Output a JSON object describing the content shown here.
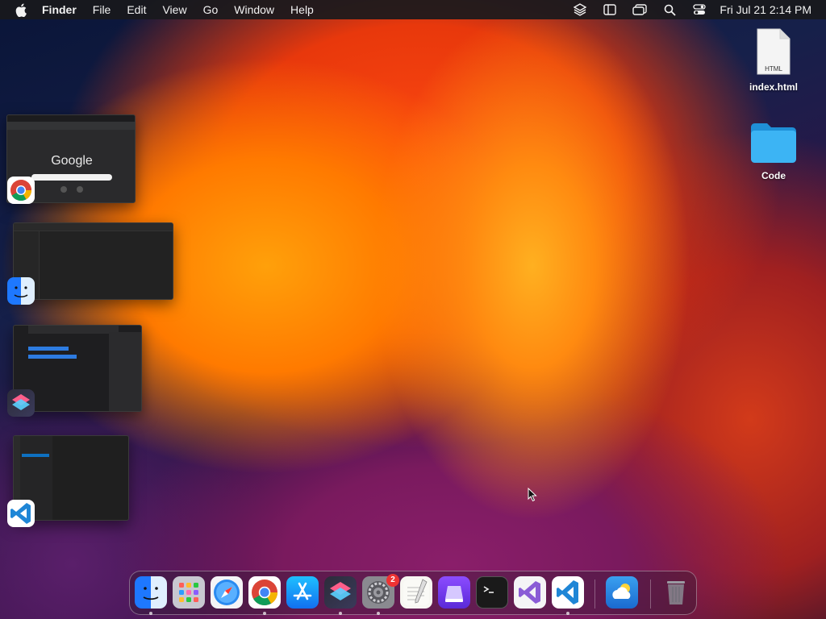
{
  "menubar": {
    "app_name": "Finder",
    "items": [
      "File",
      "Edit",
      "View",
      "Go",
      "Window",
      "Help"
    ],
    "clock": "Fri Jul 21  2:14 PM"
  },
  "desktop": {
    "files": [
      {
        "name": "index.html",
        "kind_label": "HTML"
      },
      {
        "name": "Code"
      }
    ]
  },
  "stage_manager": {
    "windows": [
      {
        "app": "Google Chrome",
        "content_text": "Google",
        "icon": "chrome-icon"
      },
      {
        "app": "Finder",
        "icon": "finder-icon"
      },
      {
        "app": "Shortcuts",
        "icon": "shortcuts-icon"
      },
      {
        "app": "Visual Studio Code",
        "icon": "vscode-icon"
      }
    ]
  },
  "dock": {
    "settings_badge": "2",
    "apps": [
      "Finder",
      "Launchpad",
      "Safari",
      "Google Chrome",
      "App Store",
      "Shortcuts",
      "System Settings",
      "TextEdit",
      "Apple Configurator",
      "Terminal",
      "Visual Studio",
      "Visual Studio Code",
      "Weather",
      "Trash"
    ]
  },
  "colors": {
    "accent": "#1a8cff",
    "menubar": "#19191c",
    "folder": "#2aa6f0"
  }
}
